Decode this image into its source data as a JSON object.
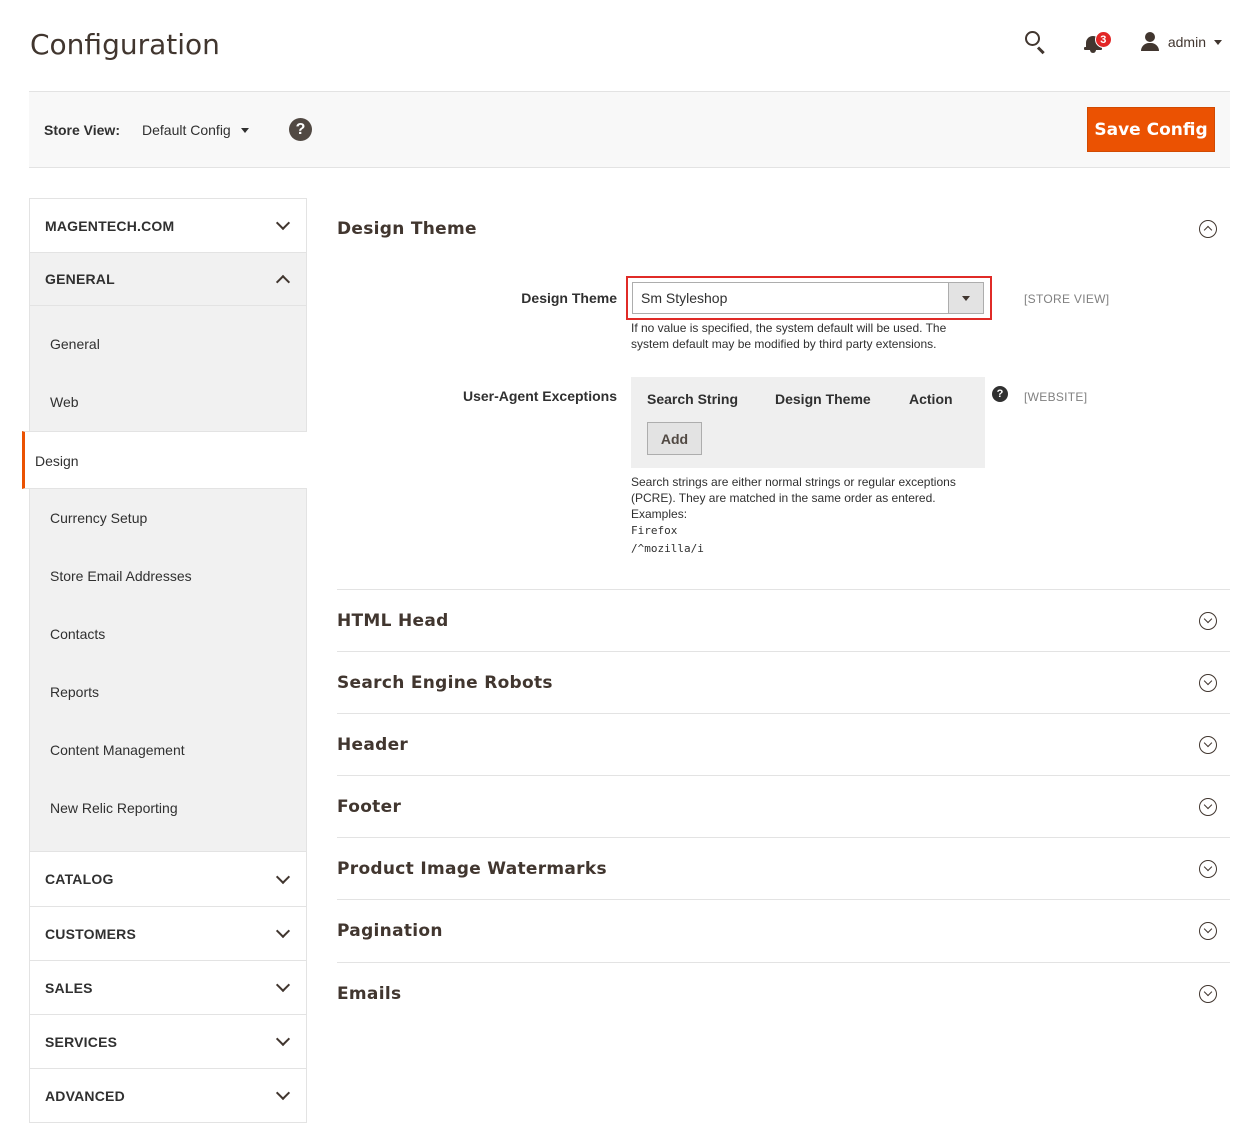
{
  "header": {
    "title": "Configuration",
    "notifications_count": "3",
    "user_name": "admin"
  },
  "store_bar": {
    "label": "Store View:",
    "value": "Default Config",
    "help": "?",
    "save_label": "Save Config"
  },
  "sidebar": {
    "top_tabs": [
      {
        "label": "MAGENTECH.COM"
      },
      {
        "label": "GENERAL"
      }
    ],
    "general_items": [
      {
        "label": "General"
      },
      {
        "label": "Web"
      },
      {
        "label": "Design"
      },
      {
        "label": "Currency Setup"
      },
      {
        "label": "Store Email Addresses"
      },
      {
        "label": "Contacts"
      },
      {
        "label": "Reports"
      },
      {
        "label": "Content Management"
      },
      {
        "label": "New Relic Reporting"
      }
    ],
    "bottom_tabs": [
      {
        "label": "CATALOG"
      },
      {
        "label": "CUSTOMERS"
      },
      {
        "label": "SALES"
      },
      {
        "label": "SERVICES"
      },
      {
        "label": "ADVANCED"
      }
    ]
  },
  "design_theme": {
    "section_title": "Design Theme",
    "field_label": "Design Theme",
    "selected": "Sm Styleshop",
    "scope": "[STORE VIEW]",
    "note": "If no value is specified, the system default will be used. The system default may be modified by third party extensions.",
    "ua_label": "User-Agent Exceptions",
    "ua_columns": [
      "Search String",
      "Design Theme",
      "Action"
    ],
    "add_label": "Add",
    "ua_help": "?",
    "ua_scope": "[WEBSITE]",
    "ua_note": "Search strings are either normal strings or regular exceptions (PCRE). They are matched in the same order as entered.",
    "ua_examples_label": "Examples:",
    "ua_example_1": "Firefox",
    "ua_example_2": "/^mozilla/i"
  },
  "sections": [
    {
      "title": "HTML Head"
    },
    {
      "title": "Search Engine Robots"
    },
    {
      "title": "Header"
    },
    {
      "title": "Footer"
    },
    {
      "title": "Product Image Watermarks"
    },
    {
      "title": "Pagination"
    },
    {
      "title": "Emails"
    }
  ]
}
